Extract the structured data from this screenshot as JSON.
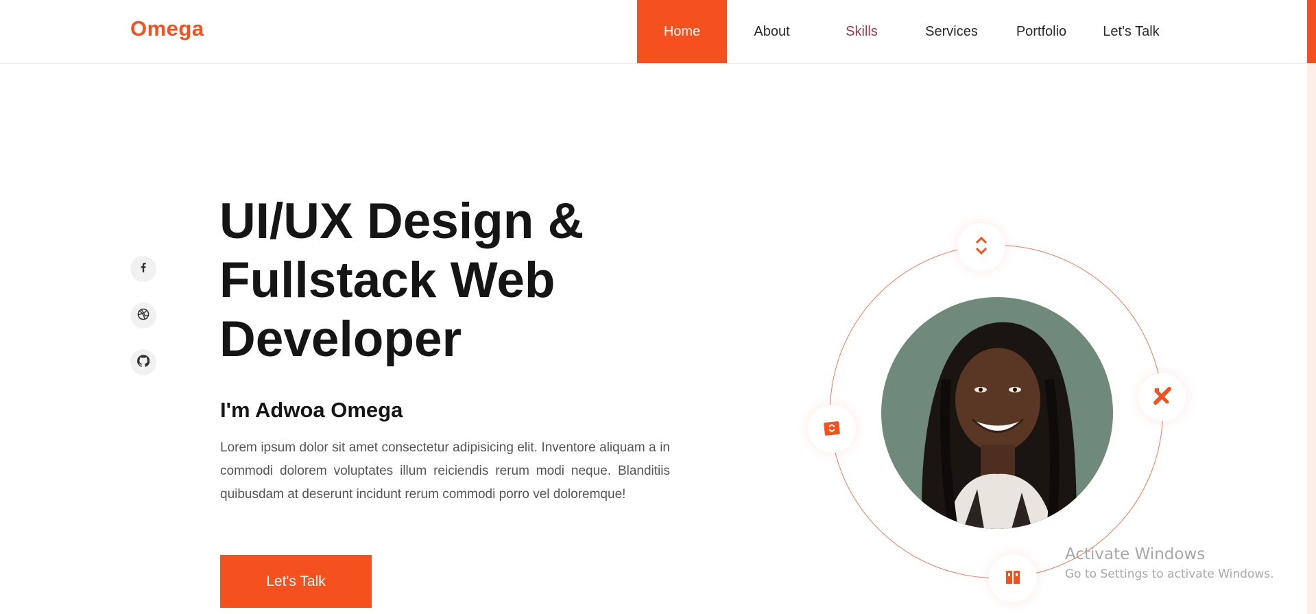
{
  "brand": {
    "name": "Omega",
    "accent_color": "#f4511e"
  },
  "nav": {
    "items": [
      {
        "label": "Home",
        "active": true
      },
      {
        "label": "About"
      },
      {
        "label": "Skills"
      },
      {
        "label": "Services"
      },
      {
        "label": "Portfolio"
      },
      {
        "label": "Let's Talk"
      }
    ]
  },
  "social": {
    "icons": [
      "facebook-icon",
      "dribbble-icon",
      "github-icon"
    ]
  },
  "hero": {
    "title": "UI/UX Design & Fullstack Web Developer",
    "name": "I'm Adwoa Omega",
    "description": "Lorem ipsum dolor sit amet consectetur adipisicing elit. Inventore aliquam a in commodi dolorem voluptates illum reiciendis rerum modi neque. Blanditiis quibusdam at deserunt incidunt rerum commodi porro vel doloremque!",
    "cta_label": "Let's Talk"
  },
  "orbit": {
    "icons": [
      "code-arrows-icon",
      "design-tools-icon",
      "portfolio-icon",
      "books-icon"
    ]
  },
  "watermark": {
    "title": "Activate Windows",
    "subtitle": "Go to Settings to activate Windows."
  }
}
